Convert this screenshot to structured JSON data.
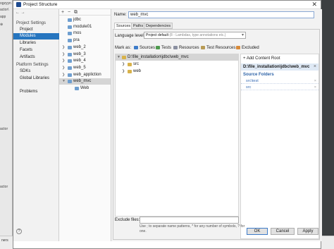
{
  "background": {
    "left_fragments": [
      "ogzyyn",
      "actor\\",
      "app",
      "⊕",
      "actor",
      "actor"
    ],
    "bottom_text": "ners"
  },
  "window": {
    "title": "Project Structure",
    "close_glyph": "✕"
  },
  "nav": {
    "arrows": "← →",
    "project_settings_header": "Project Settings",
    "project_items": [
      "Project",
      "Modules",
      "Libraries",
      "Facets",
      "Artifacts"
    ],
    "platform_settings_header": "Platform Settings",
    "platform_items": [
      "SDKs",
      "Global Libraries"
    ],
    "problems": "Problems",
    "selected": "Modules"
  },
  "modules": {
    "toolbar": [
      "+",
      "−",
      "⧉"
    ],
    "items": [
      {
        "label": "jdbc",
        "expandable": false,
        "indent": 0
      },
      {
        "label": "module01",
        "expandable": false,
        "indent": 0
      },
      {
        "label": "mos",
        "expandable": false,
        "indent": 0
      },
      {
        "label": "pra",
        "expandable": false,
        "indent": 0
      },
      {
        "label": "web_2",
        "expandable": true,
        "indent": 0
      },
      {
        "label": "web_3",
        "expandable": true,
        "indent": 0
      },
      {
        "label": "web_4",
        "expandable": true,
        "indent": 0
      },
      {
        "label": "web_5",
        "expandable": true,
        "indent": 0
      },
      {
        "label": "web_appliction",
        "expandable": true,
        "indent": 0
      },
      {
        "label": "web_mvc",
        "expandable": true,
        "expanded": true,
        "indent": 0,
        "selected": true
      },
      {
        "label": "Web",
        "expandable": false,
        "indent": 1
      }
    ]
  },
  "detail": {
    "name_label": "Name:",
    "name_value": "web_mvc",
    "tabs": [
      "Sources",
      "Paths",
      "Dependencies"
    ],
    "active_tab": "Sources",
    "language_level_label": "Language level:",
    "language_level_value": "Project default",
    "language_level_hint": "(8 - Lambdas, type annotations etc.)",
    "mark_as_label": "Mark as:",
    "mark_as_options": [
      {
        "label": "Sources",
        "color": "#3d7cc9"
      },
      {
        "label": "Tests",
        "color": "#4e9a4e"
      },
      {
        "label": "Resources",
        "color": "#8a8fa0"
      },
      {
        "label": "Test Resources",
        "color": "#b89b55"
      },
      {
        "label": "Excluded",
        "color": "#d88a3a"
      }
    ],
    "tree_root": "D:\\file_installation\\jdbc\\web_mvc",
    "tree_children": [
      "src",
      "web"
    ],
    "add_content_root": "Add Content Root",
    "content_root_path": "D:\\file_installation\\jdbc\\web_mvc",
    "source_folders_header": "Source Folders",
    "source_folders": [
      "src\\test",
      "src"
    ],
    "exclude_files_label": "Exclude files:",
    "exclude_files_hint": "Use ; to separate name patterns, * for any number of symbols, ? for one."
  },
  "buttons": {
    "ok": "OK",
    "cancel": "Cancel",
    "apply": "Apply",
    "help": "?"
  }
}
